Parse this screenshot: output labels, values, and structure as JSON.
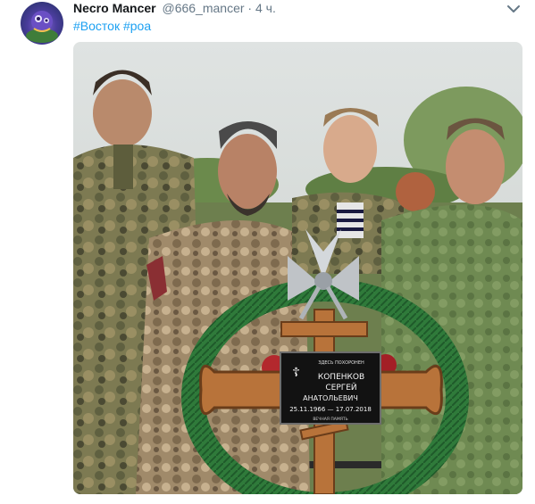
{
  "tweet": {
    "display_name": "Necro Mancer",
    "handle": "@666_mancer",
    "separator": " · ",
    "time": "4 ч.",
    "hashtags": [
      "#Восток",
      "#роа"
    ],
    "icons": {
      "avatar": "avatar-image",
      "menu": "chevron-down-icon"
    }
  },
  "photo": {
    "plaque": {
      "header": "ЗДЕСЬ ПОХОРОНЕН",
      "line1": "КОПЕНКОВ",
      "line2": "СЕРГЕЙ",
      "line3": "АНАТОЛЬЕВИЧ",
      "dates": "25.11.1966 — 17.07.2018",
      "footer": "ВЕЧНАЯ ПАМЯТЬ"
    }
  },
  "colors": {
    "hashtag": "#1da1f2",
    "name": "#14171a",
    "meta": "#657786"
  }
}
